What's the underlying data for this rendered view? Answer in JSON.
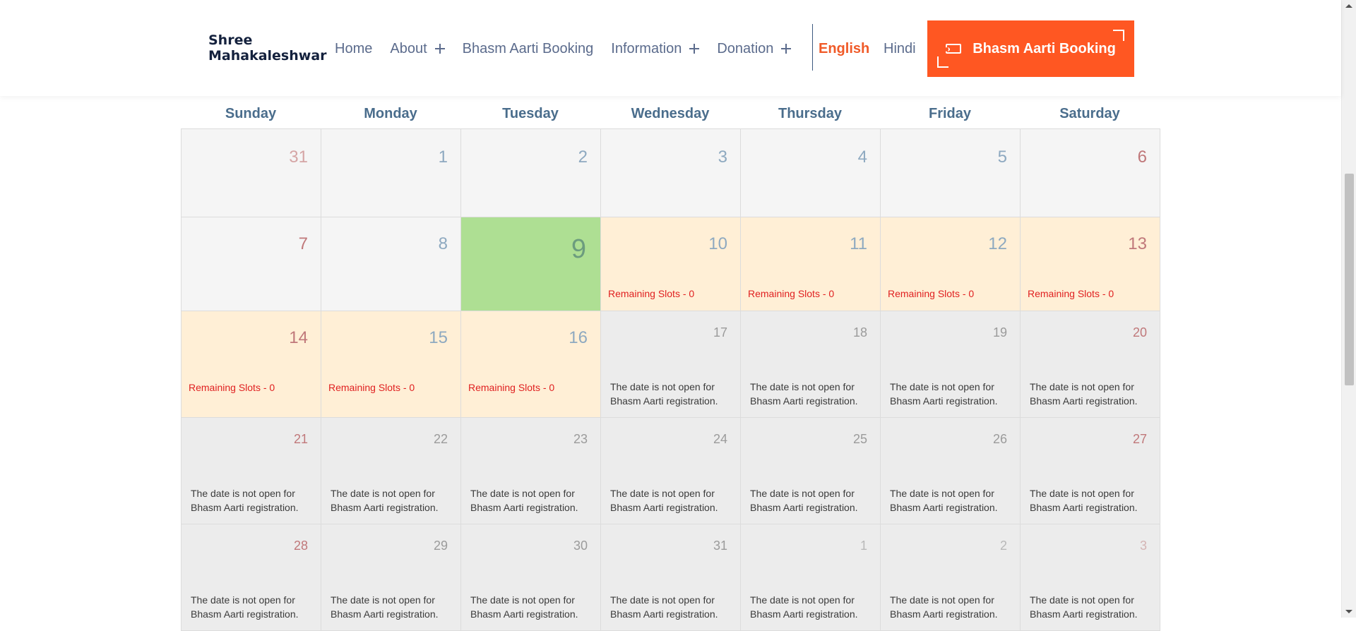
{
  "brand": {
    "line1": "Shree",
    "line2": "Mahakaleshwar"
  },
  "nav": {
    "home": "Home",
    "about": "About",
    "booking": "Bhasm Aarti Booking",
    "information": "Information",
    "donation": "Donation"
  },
  "lang": {
    "english": "English",
    "hindi": "Hindi"
  },
  "cta": {
    "label": "Bhasm Aarti Booking"
  },
  "calendar": {
    "days": [
      "Sunday",
      "Monday",
      "Tuesday",
      "Wednesday",
      "Thursday",
      "Friday",
      "Saturday"
    ],
    "slots_text": "Remaining Slots - 0",
    "not_open_text": "The date is not open for Bhasm Aarti registration.",
    "weeks": [
      [
        "31",
        "1",
        "2",
        "3",
        "4",
        "5",
        "6"
      ],
      [
        "7",
        "8",
        "9",
        "10",
        "11",
        "12",
        "13"
      ],
      [
        "14",
        "15",
        "16",
        "17",
        "18",
        "19",
        "20"
      ],
      [
        "21",
        "22",
        "23",
        "24",
        "25",
        "26",
        "27"
      ],
      [
        "28",
        "29",
        "30",
        "31",
        "1",
        "2",
        "3"
      ]
    ]
  },
  "colors": {
    "accent": "#ff5722",
    "today": "#aedf93",
    "available": "#ffefd6",
    "closed": "#ececec",
    "slots_text": "#e02020"
  }
}
